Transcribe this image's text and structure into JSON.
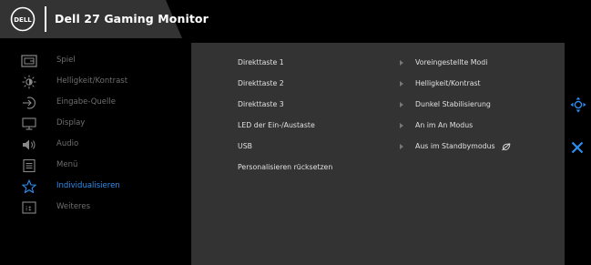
{
  "header": {
    "brand_logo_text": "DELL",
    "title": "Dell 27 Gaming Monitor"
  },
  "menu": {
    "items": [
      {
        "label": "Spiel",
        "icon": "game-icon",
        "active": false
      },
      {
        "label": "Helligkeit/Kontrast",
        "icon": "brightness-icon",
        "active": false
      },
      {
        "label": "Eingabe-Quelle",
        "icon": "input-source-icon",
        "active": false
      },
      {
        "label": "Display",
        "icon": "display-icon",
        "active": false
      },
      {
        "label": "Audio",
        "icon": "speaker-icon",
        "active": false
      },
      {
        "label": "Menü",
        "icon": "menu-icon",
        "active": false
      },
      {
        "label": "Individualisieren",
        "icon": "star-icon",
        "active": true
      },
      {
        "label": "Weiteres",
        "icon": "others-icon",
        "active": false
      }
    ]
  },
  "submenu": {
    "items": [
      {
        "label": "Direkttaste 1",
        "value": "Voreingestellte Modi"
      },
      {
        "label": "Direkttaste 2",
        "value": "Helligkeit/Kontrast"
      },
      {
        "label": "Direkttaste 3",
        "value": "Dunkel Stabilisierung"
      },
      {
        "label": "LED der Ein-/Austaste",
        "value": "An im An Modus"
      },
      {
        "label": "USB",
        "value": "Aus im Standbymodus"
      },
      {
        "label": "Personalisieren rücksetzen",
        "value": ""
      }
    ]
  },
  "controls": {
    "navigate_icon": "joystick-icon",
    "exit_icon": "close-icon"
  },
  "colors": {
    "accent": "#2b8ef0",
    "panel_bg": "#333333",
    "inactive_text": "#6e6e6e"
  }
}
